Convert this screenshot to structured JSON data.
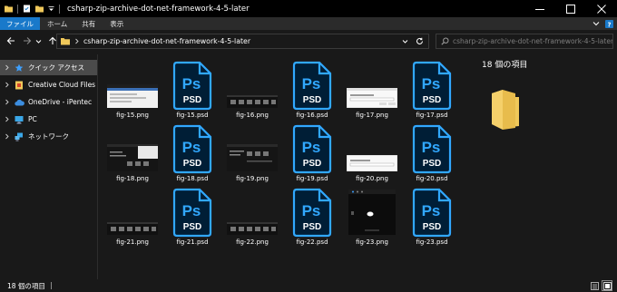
{
  "window": {
    "title": "csharp-zip-archive-dot-net-framework-4-5-later"
  },
  "ribbon": {
    "tabs": [
      {
        "label": "ファイル",
        "active": true
      },
      {
        "label": "ホーム",
        "active": false
      },
      {
        "label": "共有",
        "active": false
      },
      {
        "label": "表示",
        "active": false
      }
    ]
  },
  "address": {
    "path": "csharp-zip-archive-dot-net-framework-4-5-later"
  },
  "search": {
    "placeholder": "csharp-zip-archive-dot-net-framework-4-5-laterの検索"
  },
  "nav": {
    "items": [
      {
        "label": "クイック アクセス",
        "icon": "star-icon",
        "selected": true
      },
      {
        "label": "Creative Cloud Files",
        "icon": "creative-cloud-icon",
        "selected": false
      },
      {
        "label": "OneDrive - iPentec",
        "icon": "onedrive-cloud-icon",
        "selected": false
      },
      {
        "label": "PC",
        "icon": "computer-icon",
        "selected": false
      },
      {
        "label": "ネットワーク",
        "icon": "network-icon",
        "selected": false
      }
    ]
  },
  "files": [
    {
      "name": "fig-15.png",
      "type": "png",
      "style": "window"
    },
    {
      "name": "fig-15.psd",
      "type": "psd"
    },
    {
      "name": "fig-16.png",
      "type": "png",
      "style": "dark-strip"
    },
    {
      "name": "fig-16.psd",
      "type": "psd"
    },
    {
      "name": "fig-17.png",
      "type": "png",
      "style": "dialog"
    },
    {
      "name": "fig-17.psd",
      "type": "psd"
    },
    {
      "name": "fig-18.png",
      "type": "png",
      "style": "dark-window"
    },
    {
      "name": "fig-18.psd",
      "type": "psd"
    },
    {
      "name": "fig-19.png",
      "type": "png",
      "style": "dark-window2"
    },
    {
      "name": "fig-19.psd",
      "type": "psd"
    },
    {
      "name": "fig-20.png",
      "type": "png",
      "style": "dialog2"
    },
    {
      "name": "fig-20.psd",
      "type": "psd"
    },
    {
      "name": "fig-21.png",
      "type": "png",
      "style": "dark-strip"
    },
    {
      "name": "fig-21.psd",
      "type": "psd"
    },
    {
      "name": "fig-22.png",
      "type": "png",
      "style": "dark-strip"
    },
    {
      "name": "fig-22.psd",
      "type": "psd"
    },
    {
      "name": "fig-23.png",
      "type": "png",
      "style": "photo"
    },
    {
      "name": "fig-23.psd",
      "type": "psd"
    }
  ],
  "psd_label": "PSD",
  "psd_letters": "Ps",
  "details": {
    "title": "18 個の項目"
  },
  "status": {
    "count": "18 個の項目"
  },
  "colors": {
    "psd_fill": "#001e36",
    "psd_stroke": "#31a8ff",
    "selection": "#1979ca",
    "folder": "#f0c85a"
  }
}
